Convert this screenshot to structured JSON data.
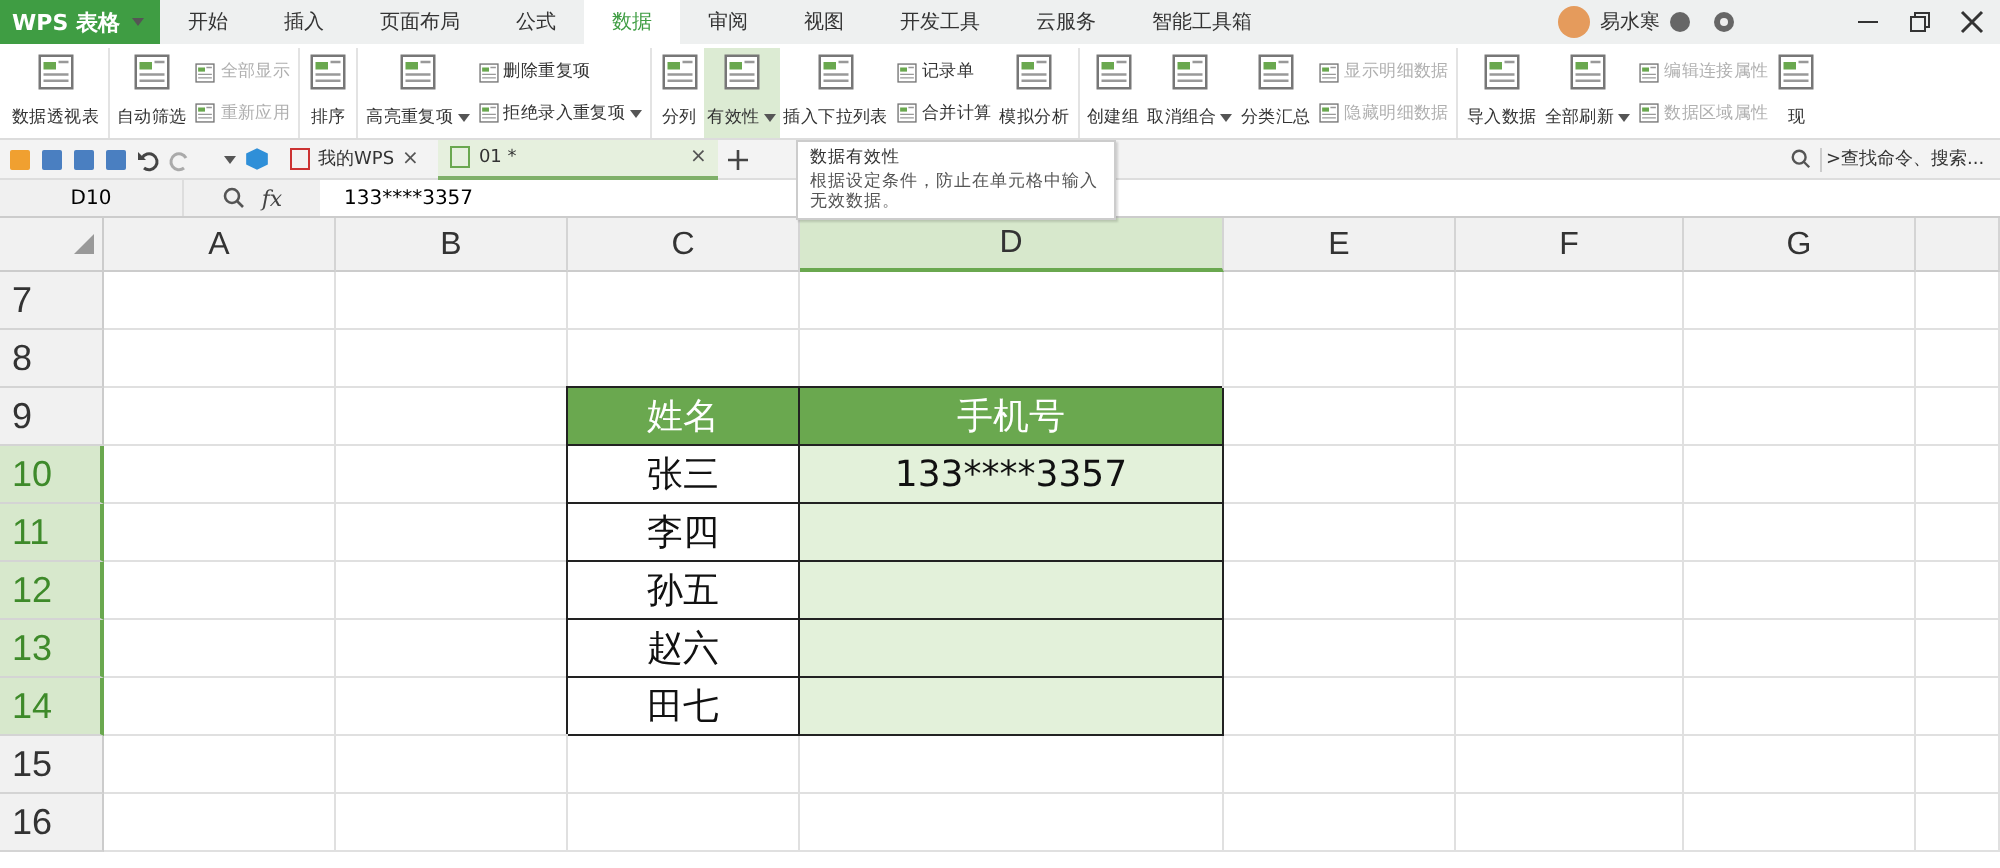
{
  "app_button": {
    "label": "WPS 表格"
  },
  "menu_tabs": [
    {
      "label": "开始",
      "selected": false
    },
    {
      "label": "插入",
      "selected": false
    },
    {
      "label": "页面布局",
      "selected": false
    },
    {
      "label": "公式",
      "selected": false
    },
    {
      "label": "数据",
      "selected": true
    },
    {
      "label": "审阅",
      "selected": false
    },
    {
      "label": "视图",
      "selected": false
    },
    {
      "label": "开发工具",
      "selected": false
    },
    {
      "label": "云服务",
      "selected": false
    },
    {
      "label": "智能工具箱",
      "selected": false
    }
  ],
  "user": {
    "name": "易水寒"
  },
  "ribbon": {
    "groups": [
      {
        "items": [
          {
            "kind": "large",
            "label": "数据透视表"
          }
        ]
      },
      {
        "items": [
          {
            "kind": "large",
            "label": "自动筛选"
          },
          {
            "kind": "stack",
            "items": [
              {
                "label": "全部显示",
                "disabled": true
              },
              {
                "label": "重新应用",
                "disabled": true
              }
            ]
          }
        ]
      },
      {
        "items": [
          {
            "kind": "large",
            "label": "排序"
          }
        ]
      },
      {
        "items": [
          {
            "kind": "large",
            "label": "高亮重复项",
            "dropdown": true
          },
          {
            "kind": "stack",
            "items": [
              {
                "label": "删除重复项",
                "disabled": false
              },
              {
                "label": "拒绝录入重复项",
                "disabled": false,
                "dropdown": true
              }
            ]
          }
        ]
      },
      {
        "items": [
          {
            "kind": "large",
            "label": "分列"
          },
          {
            "kind": "large",
            "label": "有效性",
            "dropdown": true,
            "highlighted": true
          },
          {
            "kind": "large",
            "label": "插入下拉列表"
          },
          {
            "kind": "stack",
            "items": [
              {
                "label": "记录单",
                "disabled": false
              },
              {
                "label": "合并计算",
                "disabled": false
              }
            ]
          },
          {
            "kind": "large",
            "label": "模拟分析"
          }
        ]
      },
      {
        "items": [
          {
            "kind": "large",
            "label": "创建组"
          },
          {
            "kind": "large",
            "label": "取消组合",
            "dropdown": true
          },
          {
            "kind": "large",
            "label": "分类汇总"
          },
          {
            "kind": "stack",
            "items": [
              {
                "label": "显示明细数据",
                "disabled": true
              },
              {
                "label": "隐藏明细数据",
                "disabled": true
              }
            ]
          }
        ]
      },
      {
        "items": [
          {
            "kind": "large",
            "label": "导入数据"
          },
          {
            "kind": "large",
            "label": "全部刷新",
            "dropdown": true
          },
          {
            "kind": "stack",
            "items": [
              {
                "label": "编辑连接属性",
                "disabled": true
              },
              {
                "label": "数据区域属性",
                "disabled": true
              }
            ]
          },
          {
            "kind": "large",
            "label": "现"
          }
        ]
      }
    ]
  },
  "doc_tabs": [
    {
      "label": "我的WPS",
      "selected": false,
      "close": "×"
    },
    {
      "label": "01 *",
      "selected": true,
      "close": "×"
    }
  ],
  "search": {
    "placeholder": ">查找命令、搜索..."
  },
  "formula_bar": {
    "cell": "D10",
    "fx": "fx",
    "value": "133****3357"
  },
  "tooltip": {
    "title": "数据有效性",
    "text": "根据设定条件，防止在单元格中输入无效数据。"
  },
  "columns": [
    {
      "label": "A",
      "selected": false
    },
    {
      "label": "B",
      "selected": false
    },
    {
      "label": "C",
      "selected": false
    },
    {
      "label": "D",
      "selected": true
    },
    {
      "label": "E",
      "selected": false
    },
    {
      "label": "F",
      "selected": false
    },
    {
      "label": "G",
      "selected": false
    }
  ],
  "rows": [
    {
      "label": "7",
      "selected": false,
      "cells": []
    },
    {
      "label": "8",
      "selected": false,
      "cells": []
    },
    {
      "label": "9",
      "selected": false,
      "cells": [
        {
          "kind": "header",
          "text": "姓名"
        },
        {
          "kind": "header",
          "text": "手机号"
        }
      ]
    },
    {
      "label": "10",
      "selected": true,
      "cells": [
        {
          "kind": "data",
          "text": "张三",
          "selected": false
        },
        {
          "kind": "data",
          "text": "133****3357",
          "selected": true
        }
      ]
    },
    {
      "label": "11",
      "selected": true,
      "cells": [
        {
          "kind": "data",
          "text": "李四",
          "selected": false
        },
        {
          "kind": "data",
          "selected": true
        }
      ]
    },
    {
      "label": "12",
      "selected": true,
      "cells": [
        {
          "kind": "data",
          "text": "孙五",
          "selected": false
        },
        {
          "kind": "data",
          "selected": true
        }
      ]
    },
    {
      "label": "13",
      "selected": true,
      "cells": [
        {
          "kind": "data",
          "text": "赵六",
          "selected": false
        },
        {
          "kind": "data",
          "selected": true
        }
      ]
    },
    {
      "label": "14",
      "selected": true,
      "cells": [
        {
          "kind": "data",
          "text": "田七",
          "selected": false
        },
        {
          "kind": "data",
          "selected": true
        }
      ]
    },
    {
      "label": "15",
      "selected": false,
      "cells": []
    },
    {
      "label": "16",
      "selected": false,
      "cells": []
    }
  ]
}
